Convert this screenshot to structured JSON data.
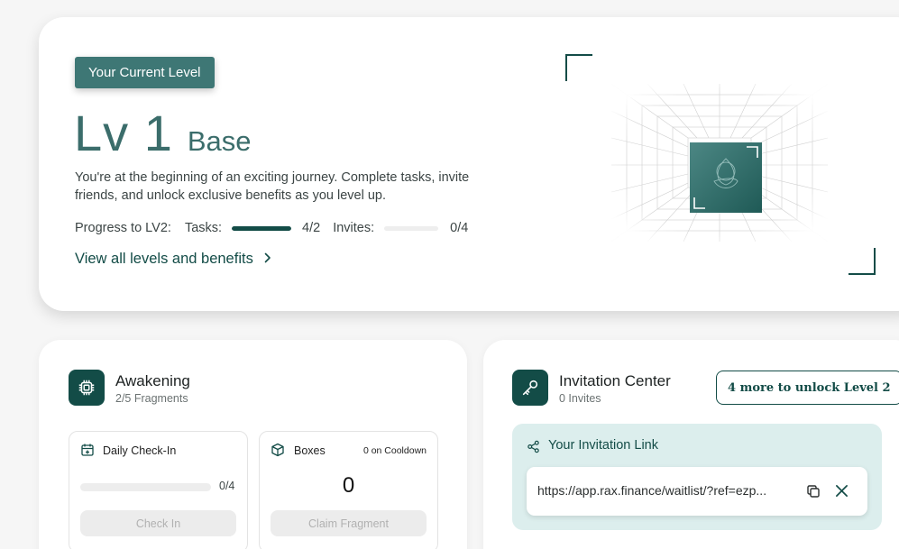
{
  "level": {
    "badge_label": "Your Current Level",
    "number": "Lv 1",
    "name": "Base",
    "description": "You're at the beginning of an exciting journey. Complete tasks, invite friends, and unlock exclusive benefits as you level up.",
    "progress_label": "Progress to LV2:",
    "tasks_label": "Tasks:",
    "tasks_value": "4/2",
    "tasks_fraction": 1.0,
    "invites_label": "Invites:",
    "invites_value": "0/4",
    "invites_fraction": 0.0,
    "view_link": "View all levels and benefits",
    "chevron_icon": "chevron-right-icon",
    "emblem_icon": "triquetra-icon"
  },
  "awakening": {
    "title": "Awakening",
    "subtitle": "2/5 Fragments",
    "icon": "chip-icon",
    "checkin": {
      "title": "Daily Check-In",
      "icon": "calendar-plus-icon",
      "value": "0/4",
      "fraction": 0,
      "button": "Check In"
    },
    "boxes": {
      "title": "Boxes",
      "icon": "cube-icon",
      "cooldown": "0 on Cooldown",
      "count": "0",
      "button": "Claim Fragment"
    }
  },
  "invitation": {
    "title": "Invitation Center",
    "subtitle": "0 Invites",
    "icon": "key-icon",
    "unlock_button": "4 more to unlock Level 2",
    "link_label": "Your Invitation Link",
    "share_icon": "share-icon",
    "link_url": "https://app.rax.finance/waitlist/?ref=ezp...",
    "copy_icon": "copy-icon",
    "x_icon": "x-logo-icon"
  },
  "colors": {
    "brand": "#134c47",
    "badge": "#3e7775",
    "panel": "#dceeed",
    "background": "#f6f6f6"
  }
}
